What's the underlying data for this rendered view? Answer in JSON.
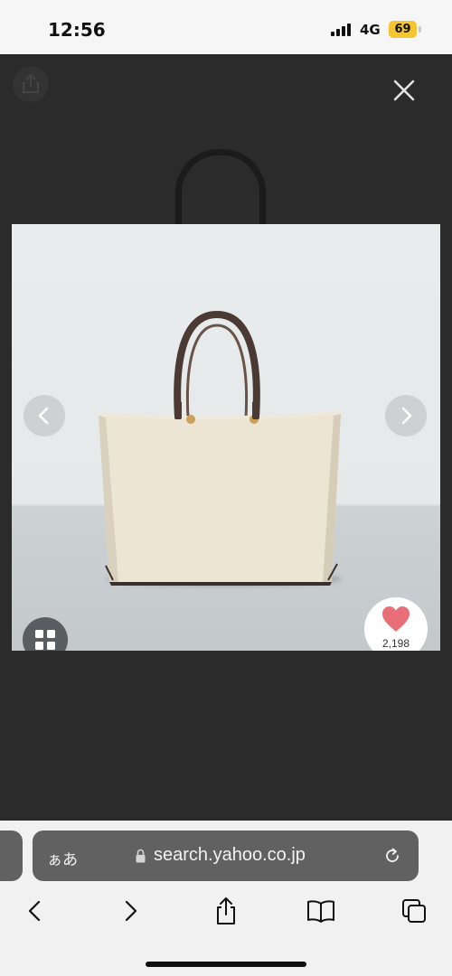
{
  "status_bar": {
    "time": "12:56",
    "network": "4G",
    "battery": "69",
    "battery_color": "#f4c531"
  },
  "viewer": {
    "icons": {
      "share": "share-icon",
      "close": "close-icon",
      "prev": "chevron-left-icon",
      "next": "chevron-right-icon",
      "grid": "grid-icon",
      "like": "heart-icon"
    },
    "like_count": "2,198",
    "heart_color": "#e86f78"
  },
  "browser": {
    "text_size_label": "ぁあ",
    "url": "search.yahoo.co.jp",
    "toolbar": [
      "back-icon",
      "forward-icon",
      "share-icon",
      "bookmarks-icon",
      "tabs-icon"
    ]
  }
}
